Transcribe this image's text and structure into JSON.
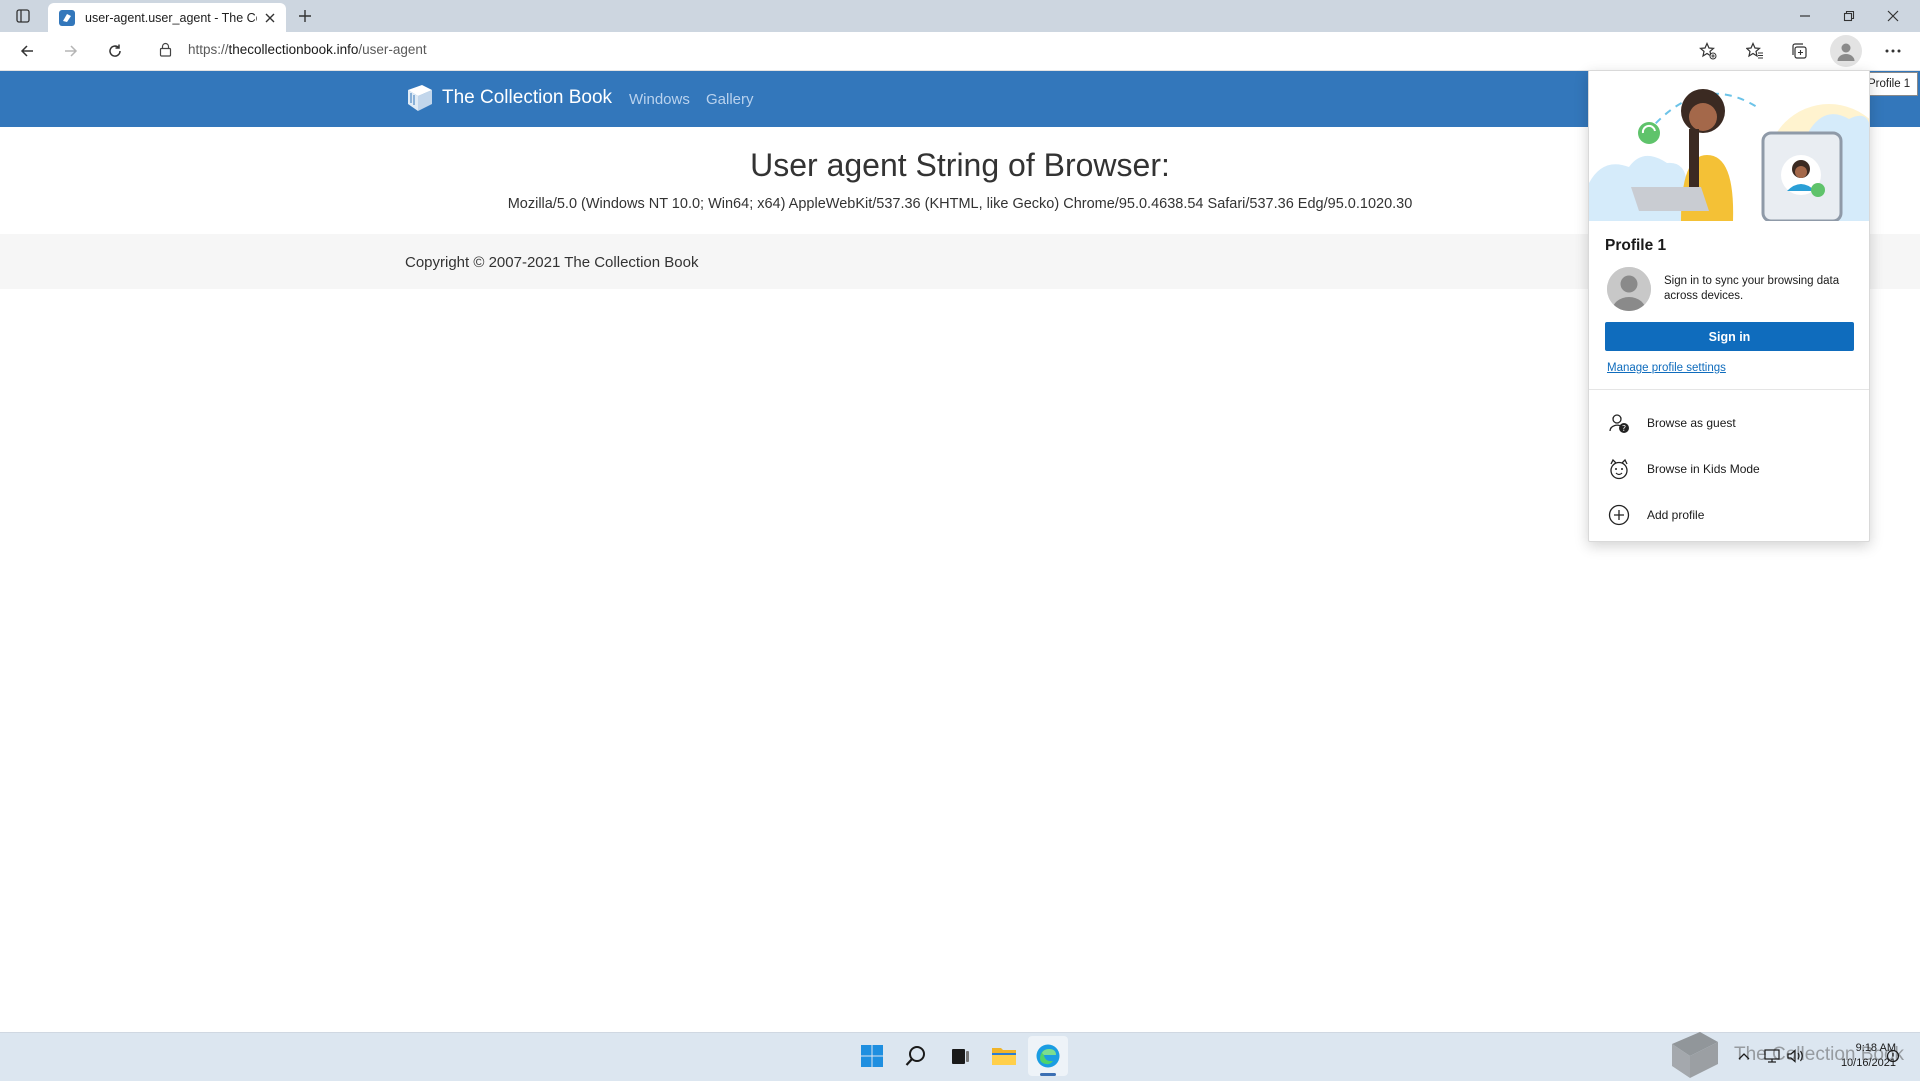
{
  "browser": {
    "tab": {
      "title": "user-agent.user_agent - The Coll"
    },
    "address": {
      "url_prefix": "https://",
      "url_host": "thecollectionbook.info",
      "url_path": "/user-agent"
    },
    "tooltip": "Profile 1"
  },
  "site": {
    "brand": "The Collection Book",
    "nav": [
      "Windows",
      "Gallery"
    ],
    "heading": "User agent String of Browser:",
    "user_agent": "Mozilla/5.0 (Windows NT 10.0; Win64; x64) AppleWebKit/537.36 (KHTML, like Gecko) Chrome/95.0.4638.54 Safari/537.36 Edg/95.0.1020.30",
    "footer": "Copyright © 2007-2021 The Collection Book"
  },
  "profile_flyout": {
    "name": "Profile 1",
    "sync_text": "Sign in to sync your browsing data across devices.",
    "sign_in": "Sign in",
    "manage": "Manage profile settings",
    "menu": [
      {
        "label": "Browse as guest",
        "icon": "guest-icon"
      },
      {
        "label": "Browse in Kids Mode",
        "icon": "kids-mode-icon"
      },
      {
        "label": "Add profile",
        "icon": "add-profile-icon"
      }
    ]
  },
  "taskbar": {
    "time": "9:18 AM",
    "date": "10/16/2021",
    "watermark": "The Collection Book"
  },
  "colors": {
    "site_nav": "#3377bb",
    "accent_button": "#0f6cbd",
    "taskbar": "#dce6f0"
  }
}
